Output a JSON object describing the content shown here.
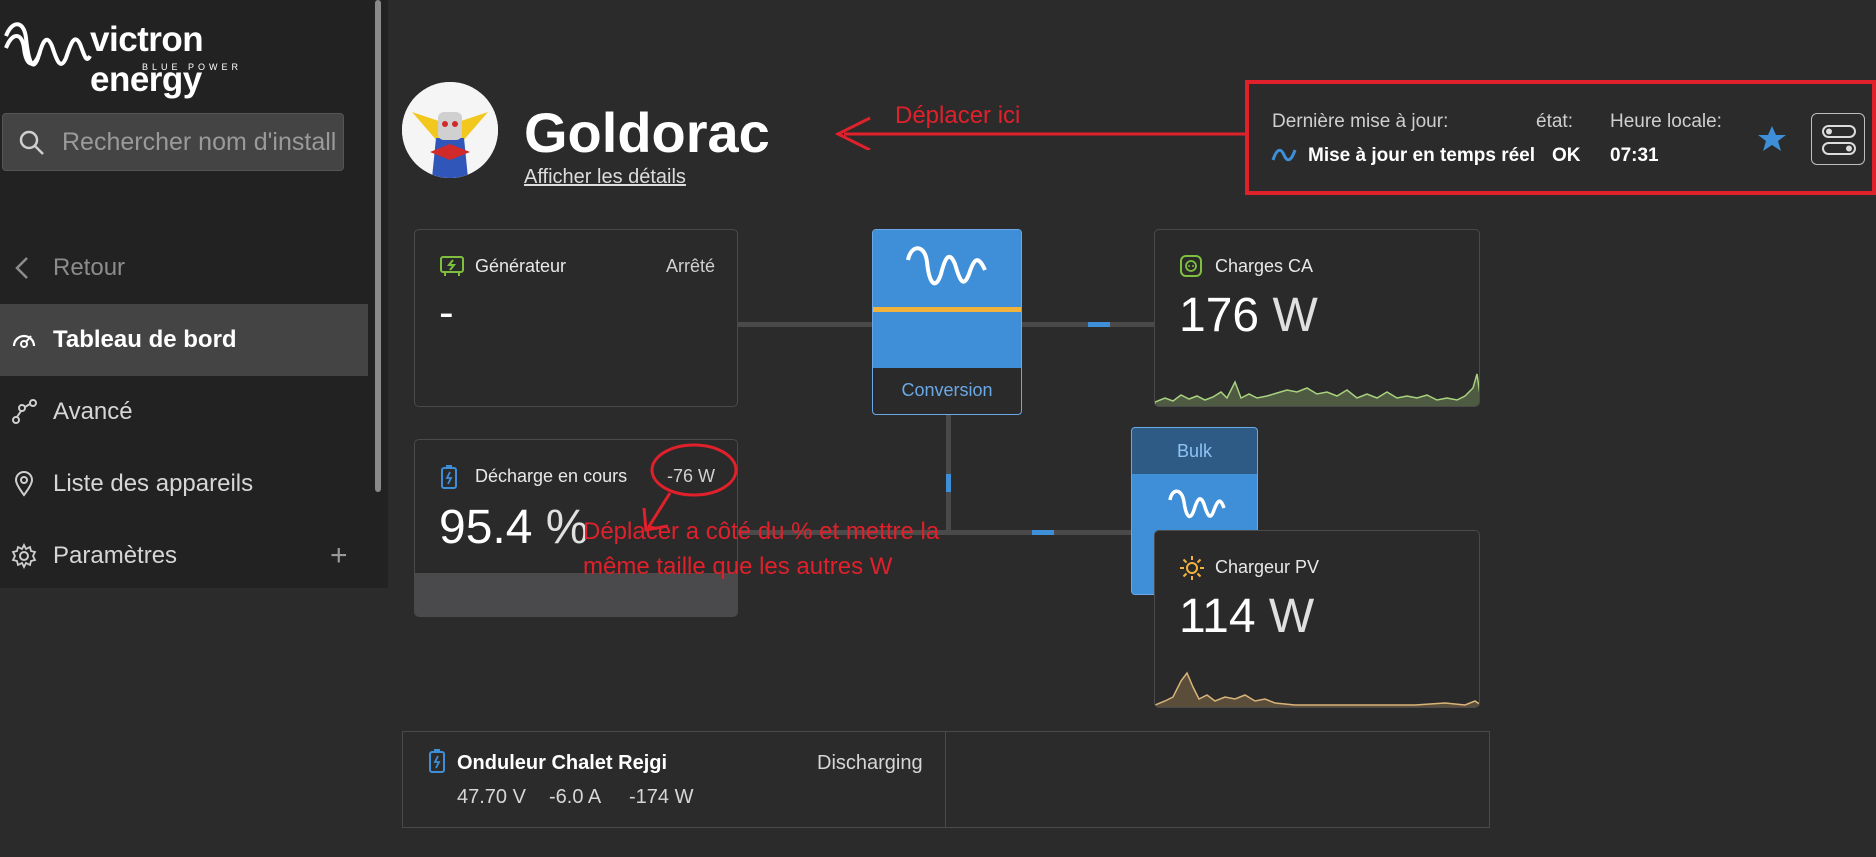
{
  "app": {
    "brand": "victron energy",
    "tagline": "BLUE POWER"
  },
  "sidebar": {
    "search_placeholder": "Rechercher nom d'install",
    "items": [
      {
        "label": "Retour",
        "icon": "chevron-left-icon"
      },
      {
        "label": "Tableau de bord",
        "icon": "dashboard-gauge-icon",
        "active": true
      },
      {
        "label": "Avancé",
        "icon": "graph-nodes-icon"
      },
      {
        "label": "Liste des appareils",
        "icon": "map-pin-icon"
      },
      {
        "label": "Paramètres",
        "icon": "gear-icon",
        "expand": "+"
      }
    ]
  },
  "header": {
    "site_name": "Goldorac",
    "details_link": "Afficher les détails"
  },
  "status": {
    "last_update_label": "Dernière mise à jour:",
    "last_update_value": "Mise à jour en temps réel",
    "state_label": "état:",
    "state_value": "OK",
    "time_label": "Heure locale:",
    "time_value": "07:31"
  },
  "annotations": {
    "move_here": "Déplacer ici",
    "move_next_line1": "Déplacer a côté du % et mettre la",
    "move_next_line2": "même taille que les autres W"
  },
  "cards": {
    "generator": {
      "title": "Générateur",
      "state": "Arrêté",
      "value": "-"
    },
    "battery": {
      "title": "Décharge en cours",
      "power": "-76 W",
      "soc_value": "95.4",
      "soc_unit": "%"
    },
    "ac_loads": {
      "title": "Charges CA",
      "value": "176",
      "unit": "W"
    },
    "pv_charger": {
      "title": "Chargeur PV",
      "value": "114",
      "unit": "W"
    }
  },
  "conversion": {
    "label": "Conversion"
  },
  "mppt": {
    "state": "Bulk"
  },
  "device": {
    "name": "Onduleur Chalet Rejgi",
    "state": "Discharging",
    "voltage": "47.70 V",
    "current": "-6.0 A",
    "power": "-174 W"
  },
  "colors": {
    "accent_blue": "#3f8fd8",
    "annotation_red": "#e0212b",
    "orange": "#f2b33d",
    "green": "#7fbf3f"
  }
}
